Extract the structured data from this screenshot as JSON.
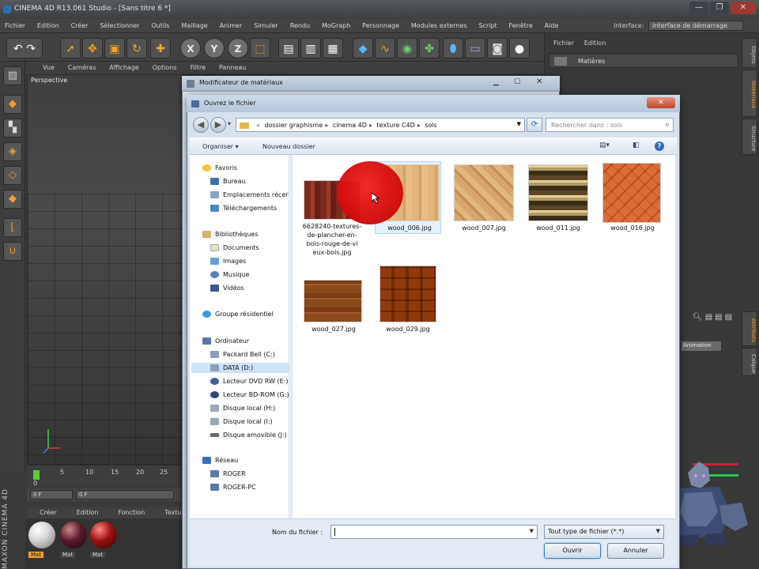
{
  "app": {
    "title": "CINEMA 4D R13.061 Studio - [Sans titre 6 *]",
    "window_buttons": [
      "—",
      "❐",
      "✕"
    ]
  },
  "menubar": {
    "items": [
      "Fichier",
      "Edition",
      "Créer",
      "Sélectionner",
      "Outils",
      "Maillage",
      "Animer",
      "Simuler",
      "Rendu",
      "MoGraph",
      "Personnage",
      "Modules externes",
      "Script",
      "Fenêtre",
      "Aide"
    ],
    "interface_label": "Interface:",
    "interface_value": "Interface de démarrage"
  },
  "viewport": {
    "menu": [
      "Vue",
      "Caméras",
      "Affichage",
      "Options",
      "Filtre",
      "Panneau"
    ],
    "title": "Perspective"
  },
  "timeline": {
    "ticks": [
      "0",
      "5",
      "10",
      "15",
      "20",
      "25"
    ],
    "frame_start": "0 F",
    "frame_field": "0 F"
  },
  "materials_manager": {
    "menu": [
      "Créer",
      "Edition",
      "Fonction",
      "Texture"
    ],
    "materials": [
      {
        "name": "Mat",
        "color": "#d8d8d8",
        "label_bg": "#f0a030",
        "label_fg": "#111"
      },
      {
        "name": "Mat",
        "color": "#5a1a2a",
        "label_bg": "#444",
        "label_fg": "#ddd"
      },
      {
        "name": "Mat",
        "color": "#9a1010",
        "label_bg": "#444",
        "label_fg": "#ddd"
      }
    ],
    "brand": "MAXON CINEMA 4D"
  },
  "right_panel": {
    "menu": [
      "Fichier",
      "Edition"
    ],
    "materials_label": "Matières",
    "vtabs": [
      "Objets",
      "Matériaux",
      "Structure",
      "Attributs",
      "Calque"
    ],
    "animation_label": "Animation"
  },
  "material_dialog": {
    "title": "Modificateur de matériaux"
  },
  "file_dialog": {
    "title": "Ouvrez le fichier",
    "path": [
      "dossier graphisme",
      "cinema 4D",
      "texture C4D",
      "sols"
    ],
    "search_placeholder": "Rechercher dans : sols",
    "organize": "Organiser ▾",
    "new_folder": "Nouveau dossier",
    "nav": {
      "favorites": {
        "label": "Favoris",
        "items": [
          "Bureau",
          "Emplacements récents",
          "Téléchargements"
        ]
      },
      "libraries": {
        "label": "Bibliothèques",
        "items": [
          "Documents",
          "Images",
          "Musique",
          "Vidéos"
        ]
      },
      "homegroup": "Groupe résidentiel",
      "computer": {
        "label": "Ordinateur",
        "items": [
          "Packard Bell (C:)",
          "DATA (D:)",
          "Lecteur DVD RW (E:)",
          "Lecteur BD-ROM (G:)",
          "Disque local (H:)",
          "Disque local (I:)",
          "Disque amovible (J:)"
        ]
      },
      "network": {
        "label": "Réseau",
        "items": [
          "ROGER",
          "ROGER-PC"
        ]
      }
    },
    "files": [
      {
        "name": "6628240-textures-de-plancher-en-bois-rouge-de-vieux-bois.jpg",
        "lines": [
          "6628240-textures-",
          "de-plancher-en-",
          "bois-rouge-de-vi",
          "eux-bois.jpg"
        ]
      },
      {
        "name": "wood_006.jpg"
      },
      {
        "name": "wood_007.jpg"
      },
      {
        "name": "wood_011.jpg"
      },
      {
        "name": "wood_016.jpg"
      },
      {
        "name": "wood_027.jpg"
      },
      {
        "name": "wood_029.jpg"
      }
    ],
    "filename_label": "Nom du fichier :",
    "filename_value": "",
    "filetype": "Tout type de fichier (*.*)",
    "open": "Ouvrir",
    "cancel": "Annuler"
  }
}
